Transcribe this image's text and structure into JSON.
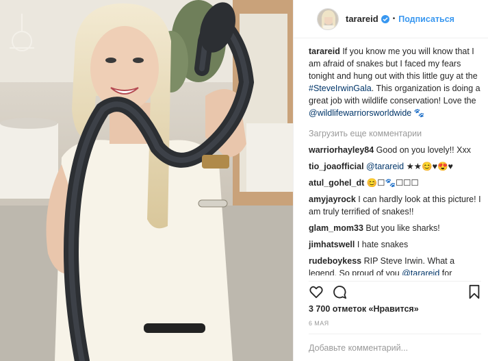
{
  "photo": {
    "description_icon": "photo"
  },
  "header": {
    "username": "tarareid",
    "verified_icon": "verified-badge-icon",
    "separator": "•",
    "follow_label": "Подписаться"
  },
  "caption": {
    "username": "tarareid",
    "text_1": " If you know me you will know that I am afraid of snakes but I faced my fears tonight and hung out with this little guy at the ",
    "hashtag": "#SteveIrwinGala",
    "text_2": ". This organization is doing a great job with wildlife conservation! Love the ",
    "mention": "@wildlifewarriorsworldwide",
    "emoji": " 🐾"
  },
  "load_more": "Загрузить еще комментарии",
  "comments": [
    {
      "user": "warriorhayley84",
      "text": " Good on you lovely!! Xxx"
    },
    {
      "user": "tio_joaofficial",
      "mention": " @tarareid",
      "text": " ★★😊♥😍♥"
    },
    {
      "user": "atul_gohel_dt",
      "text": " 😊☐🐾☐☐☐"
    },
    {
      "user": "amyjayrock",
      "text": " I can hardly look at this picture! I am truly terrified of snakes!!"
    },
    {
      "user": "glam_mom33",
      "text": " But you like sharks!"
    },
    {
      "user": "jimhatswell",
      "text": " I hate snakes"
    },
    {
      "user": "rudeboykess",
      "text_1": " RIP Steve Irwin. What a legend. So proud of you ",
      "mention": "@tarareid",
      "text_2": " for keeping his legacy alive and well. Thank"
    }
  ],
  "actions": {
    "like_icon": "heart-icon",
    "comment_icon": "comment-icon",
    "save_icon": "bookmark-icon"
  },
  "likes": "3 700 отметок «Нравится»",
  "date": "6 МАЯ",
  "add_comment": {
    "placeholder": "Добавьте комментарий..."
  },
  "colors": {
    "link": "#3897f0",
    "mention": "#003569",
    "muted": "#999999",
    "text": "#262626"
  }
}
